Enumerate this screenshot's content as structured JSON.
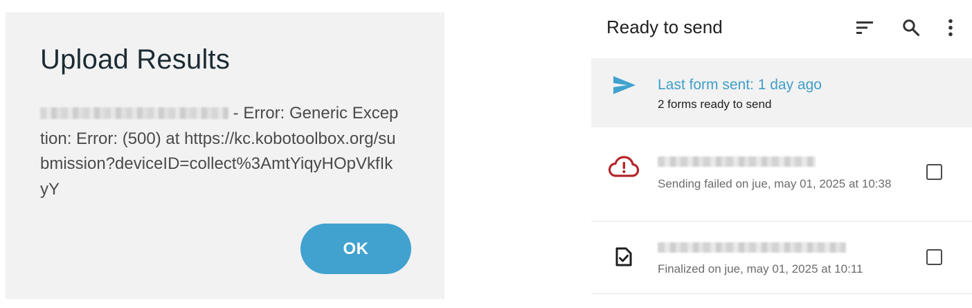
{
  "dialog": {
    "title": "Upload Results",
    "message": " - Error: Generic Exception: Error:  (500) at https://kc.kobotoolbox.org/submission?deviceID=collect%3AmtYiqyHOpVkfIkyY",
    "ok_label": "OK"
  },
  "panel": {
    "title": "Ready to send",
    "icons": {
      "sort": "sort-icon",
      "search": "search-icon",
      "more": "more-vert-icon"
    },
    "summary": {
      "icon": "send-icon",
      "title": "Last form sent: 1 day ago",
      "subtitle": "2 forms ready to send"
    },
    "forms": [
      {
        "icon": "cloud-error-icon",
        "status": "Sending failed on jue, may 01, 2025 at 10:38",
        "checked": false
      },
      {
        "icon": "finalized-document-icon",
        "status": "Finalized on jue, may 01, 2025 at 10:11",
        "checked": false
      }
    ]
  },
  "colors": {
    "accent": "#41a2cf",
    "summary_title": "#3f9ec9",
    "error": "#b3262b",
    "dialog_bg": "#f2f2f2"
  }
}
